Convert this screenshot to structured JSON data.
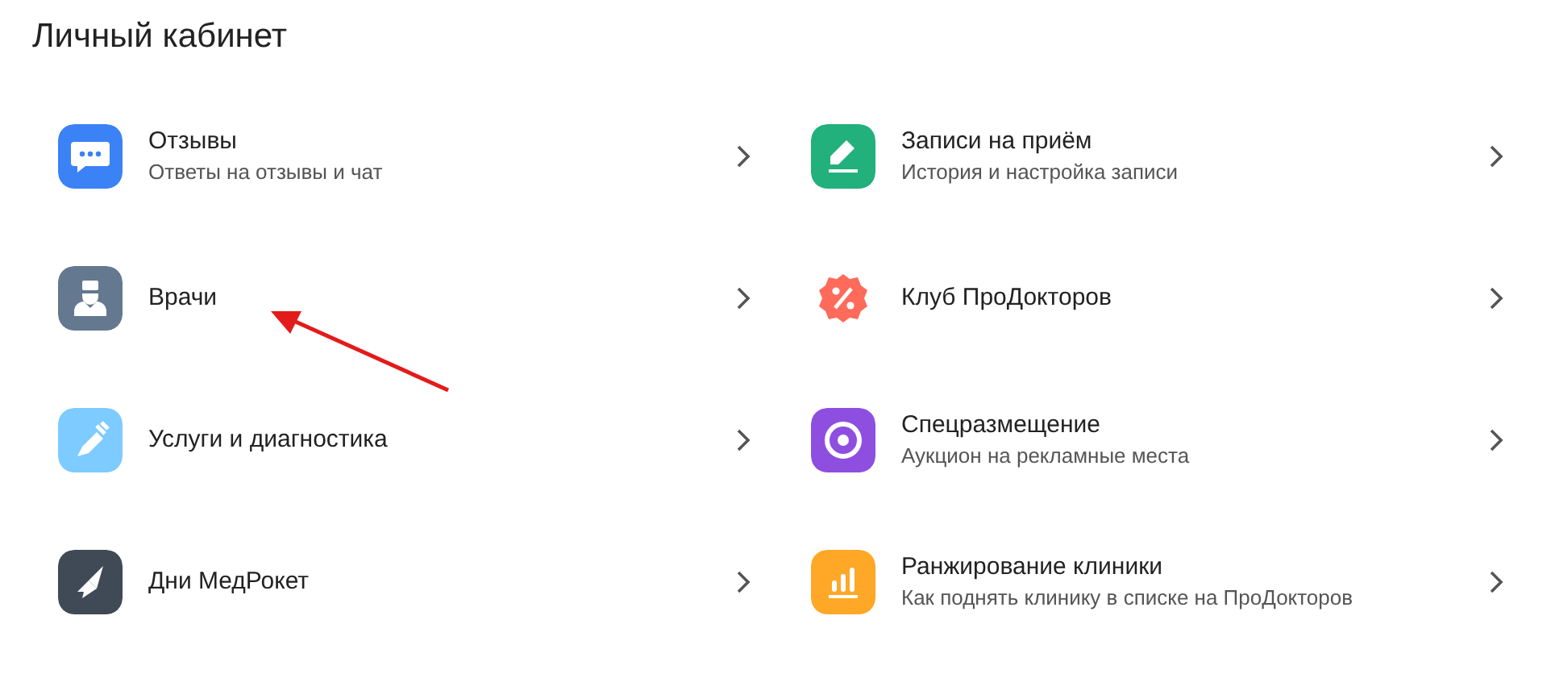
{
  "title": "Личный кабинет",
  "rows": [
    {
      "items": [
        {
          "title": "Отзывы",
          "subtitle": "Ответы на отзывы и чат",
          "color": "#3b82f6"
        },
        {
          "title": "Записи на приём",
          "subtitle": "История и настройка записи",
          "color": "#22b07d"
        }
      ]
    },
    {
      "items": [
        {
          "title": "Врачи",
          "color": "#64788f"
        },
        {
          "title": "Клуб ПроДокторов",
          "color": "#ff6b5b"
        }
      ]
    },
    {
      "items": [
        {
          "title": "Услуги и диагностика",
          "color": "#7dcbff"
        },
        {
          "title": "Спецразмещение",
          "subtitle": "Аукцион на рекламные места",
          "color": "#8e4fe0"
        }
      ]
    },
    {
      "items": [
        {
          "title": "Дни МедРокет",
          "color": "#404a57"
        },
        {
          "title": "Ранжирование клиники",
          "subtitle": "Как поднять клинику в списке на ПроДокторов",
          "color": "#ffa726"
        }
      ]
    }
  ]
}
